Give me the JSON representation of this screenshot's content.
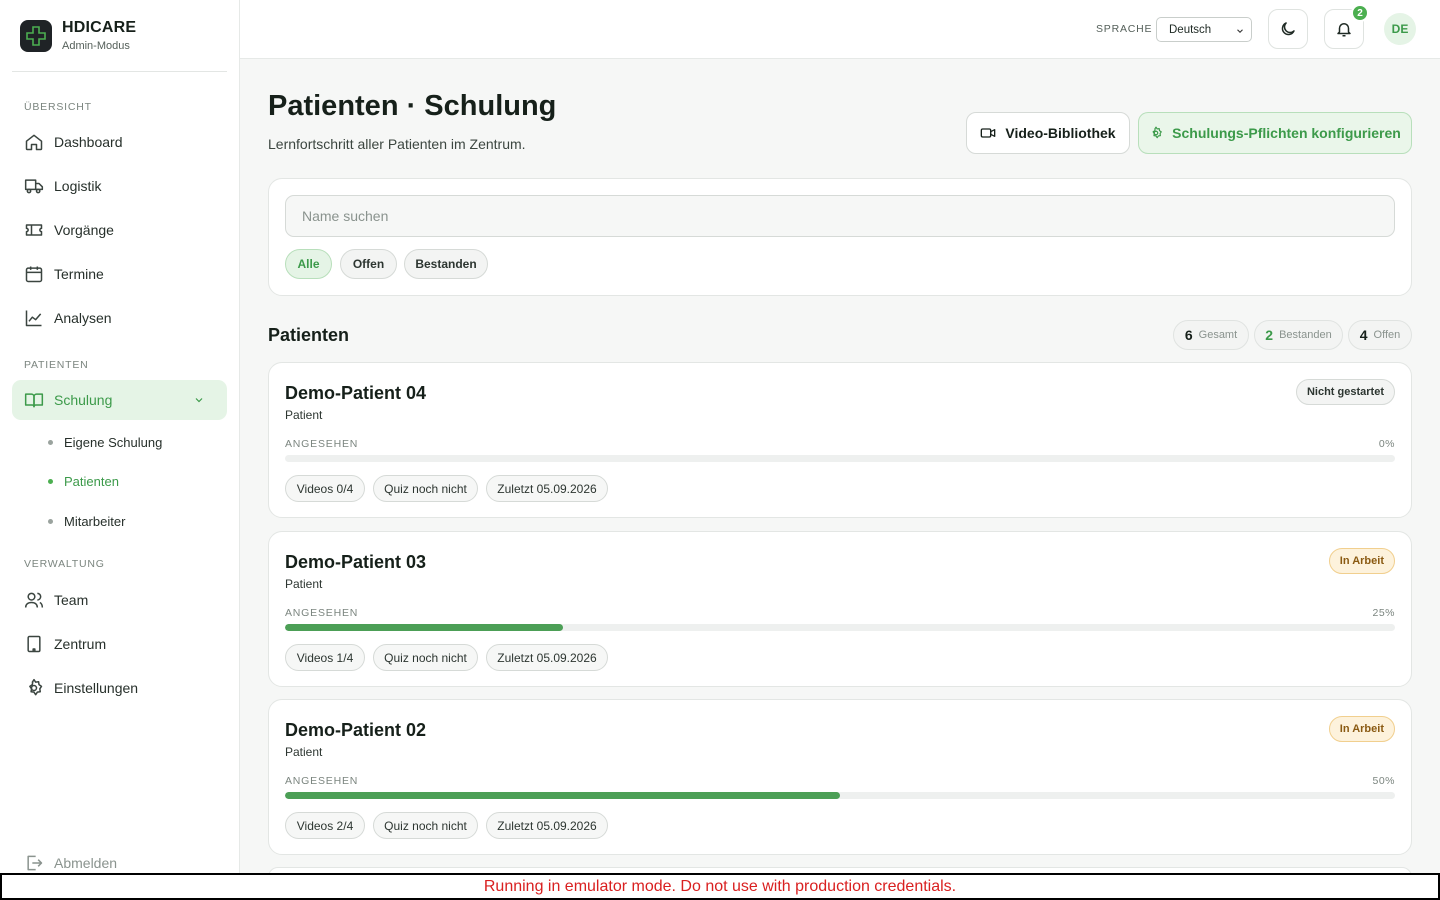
{
  "brand": {
    "name": "HDICARE",
    "mode": "Admin-Modus"
  },
  "sidebar": {
    "sections": {
      "overview": "ÜBERSICHT",
      "patients": "PATIENTEN",
      "admin": "VERWALTUNG"
    },
    "items": {
      "dashboard": "Dashboard",
      "logistics": "Logistik",
      "processes": "Vorgänge",
      "appointments": "Termine",
      "analytics": "Analysen",
      "training": "Schulung",
      "team": "Team",
      "center": "Zentrum",
      "settings": "Einstellungen",
      "logout": "Abmelden"
    },
    "training_sub": {
      "own": "Eigene Schulung",
      "patients": "Patienten",
      "staff": "Mitarbeiter"
    }
  },
  "topbar": {
    "language_label": "SPRACHE",
    "language_value": "Deutsch",
    "notification_count": "2",
    "avatar_initials": "DE"
  },
  "page": {
    "title": "Patienten · Schulung",
    "subtitle": "Lernfortschritt aller Patienten im Zentrum.",
    "video_library_button": "Video-Bibliothek",
    "configure_button": "Schulungs-Pflichten konfigurieren"
  },
  "filters": {
    "search_placeholder": "Name suchen",
    "chips": {
      "all": "Alle",
      "open": "Offen",
      "passed": "Bestanden"
    },
    "active": "all"
  },
  "patients_section": {
    "title": "Patienten",
    "stats": {
      "total": {
        "count": "6",
        "label": "Gesamt"
      },
      "passed": {
        "count": "2",
        "label": "Bestanden"
      },
      "open": {
        "count": "4",
        "label": "Offen"
      }
    }
  },
  "patients": [
    {
      "name": "Demo-Patient 04",
      "role": "Patient",
      "status": "Nicht gestartet",
      "progress_label": "ANGESEHEN",
      "progress_text": "0%",
      "progress": 0,
      "videos": "Videos 0/4",
      "quiz": "Quiz noch nicht",
      "last": "Zuletzt 05.09.2026"
    },
    {
      "name": "Demo-Patient 03",
      "role": "Patient",
      "status": "In Arbeit",
      "progress_label": "ANGESEHEN",
      "progress_text": "25%",
      "progress": 25,
      "videos": "Videos 1/4",
      "quiz": "Quiz noch nicht",
      "last": "Zuletzt 05.09.2026"
    },
    {
      "name": "Demo-Patient 02",
      "role": "Patient",
      "status": "In Arbeit",
      "progress_label": "ANGESEHEN",
      "progress_text": "50%",
      "progress": 50,
      "videos": "Videos 2/4",
      "quiz": "Quiz noch nicht",
      "last": "Zuletzt 05.09.2026"
    }
  ],
  "colors": {
    "accent": "#4caf50",
    "accent_text": "#3c9a4a",
    "amber": "#f1cf8e"
  },
  "banner": "Running in emulator mode. Do not use with production credentials."
}
